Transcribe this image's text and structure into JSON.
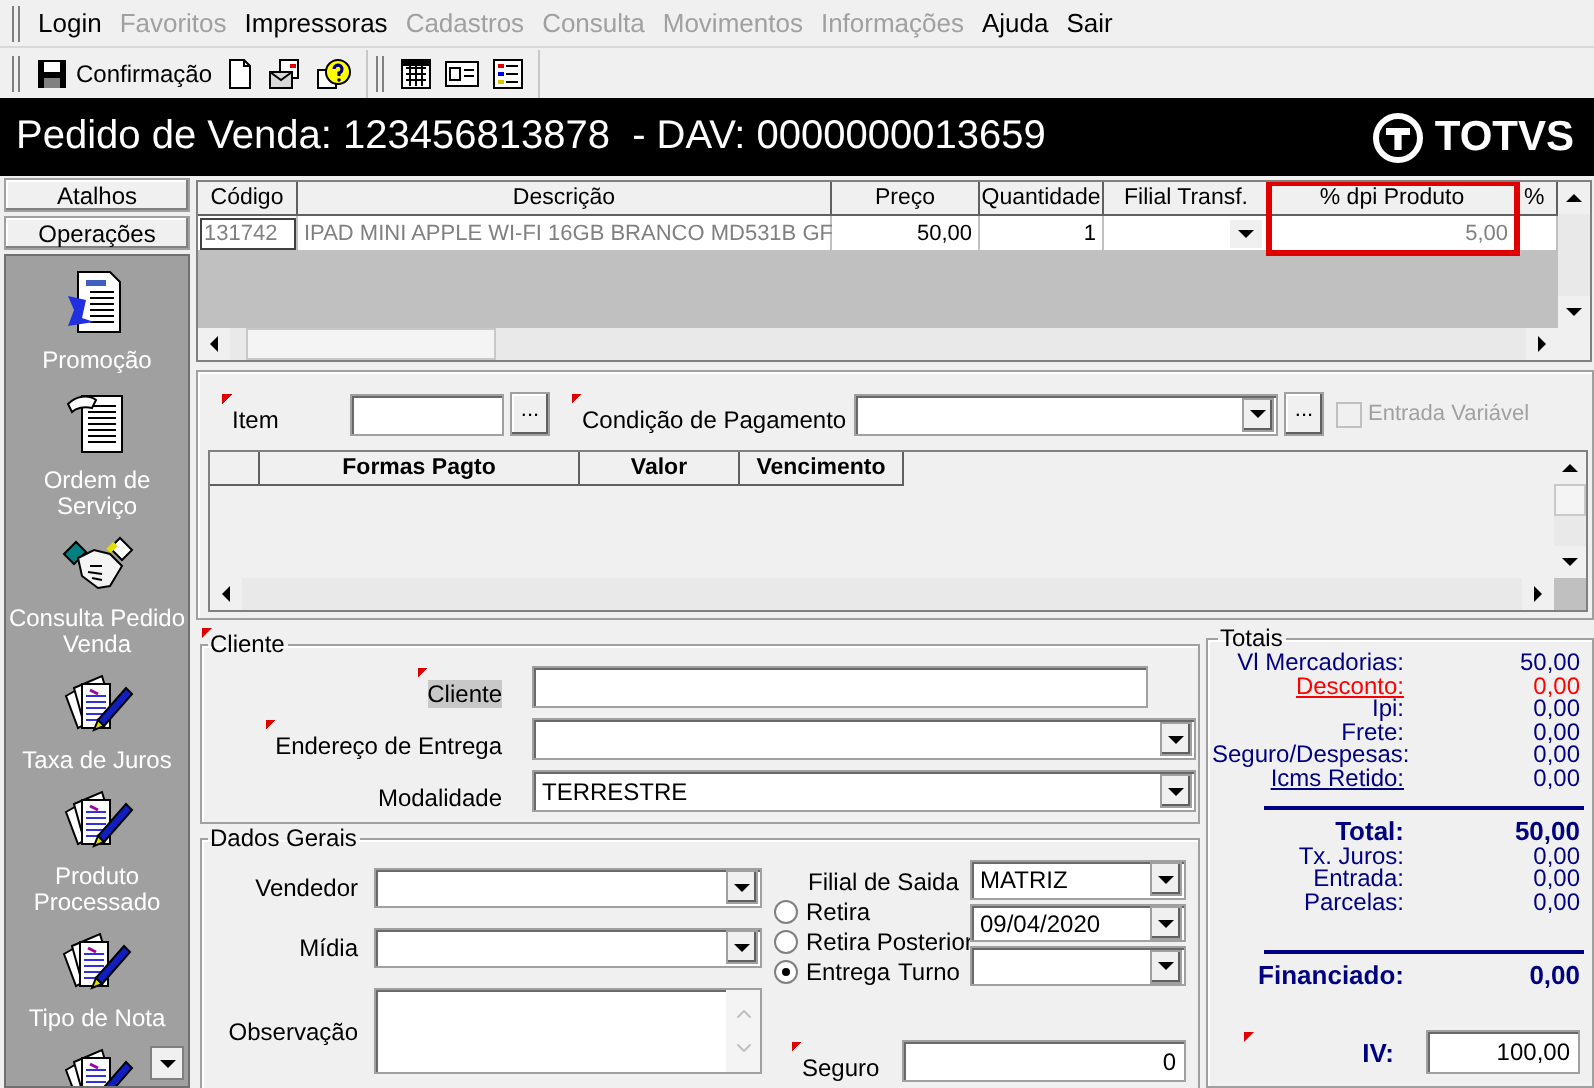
{
  "menu": [
    {
      "label": "Login",
      "disabled": false
    },
    {
      "label": "Favoritos",
      "disabled": true
    },
    {
      "label": "Impressoras",
      "disabled": false
    },
    {
      "label": "Cadastros",
      "disabled": true
    },
    {
      "label": "Consulta",
      "disabled": true
    },
    {
      "label": "Movimentos",
      "disabled": true
    },
    {
      "label": "Informações",
      "disabled": true
    },
    {
      "label": "Ajuda",
      "disabled": false
    },
    {
      "label": "Sair",
      "disabled": false
    }
  ],
  "toolbar": {
    "confirm_label": "Confirmação"
  },
  "header": {
    "title": "Pedido de Venda: 123456813878  - DAV: 0000000013659",
    "logo": "TOTVS"
  },
  "sidebar": {
    "tabs": [
      {
        "label": "Atalhos"
      },
      {
        "label": "Operações"
      }
    ],
    "items": [
      {
        "label": "Promoção",
        "kind": "report"
      },
      {
        "label": "Ordem de Serviço",
        "kind": "form"
      },
      {
        "label": "Consulta Pedido Venda",
        "kind": "handshake"
      },
      {
        "label": "Taxa de Juros",
        "kind": "papers"
      },
      {
        "label": "Produto Processado",
        "kind": "papers"
      },
      {
        "label": "Tipo de Nota",
        "kind": "papers"
      },
      {
        "kind": "papers"
      }
    ]
  },
  "products": {
    "columns": [
      {
        "label": "Código",
        "highlighted": false
      },
      {
        "label": "Descrição",
        "highlighted": false
      },
      {
        "label": "Preço",
        "highlighted": false
      },
      {
        "label": "Quantidade",
        "highlighted": false
      },
      {
        "label": "Filial Transf.",
        "highlighted": false
      },
      {
        "label": "% dpi Produto",
        "highlighted": true
      },
      {
        "label": "%",
        "highlighted": false
      }
    ],
    "rows": [
      {
        "cells": [
          {
            "text": "131742",
            "kind": "muted",
            "focused": true
          },
          {
            "text": "IPAD MINI APPLE WI-FI 16GB BRANCO MD531B  GF",
            "kind": "muted",
            "focused": false
          },
          {
            "text": "50,00",
            "kind": "number",
            "focused": false
          },
          {
            "text": "1",
            "kind": "number",
            "focused": false
          },
          {
            "kind": "select",
            "focused": false
          },
          {
            "text": "5,00",
            "kind": "muted-number",
            "focused": false
          },
          {
            "kind": "empty",
            "focused": false
          }
        ]
      }
    ]
  },
  "payment": {
    "item": {
      "label": "Item",
      "required": true,
      "button": "..."
    },
    "condition": {
      "label": "Condição de Pagamento",
      "required": true,
      "button": "..."
    },
    "variable_entry": {
      "label": "Entrada Variável",
      "checked": false,
      "disabled": true
    },
    "columns": [
      "Formas Pagto",
      "Valor",
      "Vencimento"
    ]
  },
  "client": {
    "title": "Cliente",
    "required": true,
    "fields": [
      {
        "label": "Cliente",
        "kind": "text",
        "required": true,
        "focused": true
      },
      {
        "label": "Endereço de Entrega",
        "kind": "combo",
        "required": true,
        "focused": false
      },
      {
        "label": "Modalidade",
        "kind": "combo",
        "required": false,
        "focused": false,
        "value": "TERRESTRE"
      }
    ]
  },
  "general": {
    "title": "Dados Gerais",
    "fields": [
      {
        "label": "Vendedor",
        "kind": "combo"
      },
      {
        "label": "Mídia",
        "kind": "combo"
      },
      {
        "label": "Observação",
        "kind": "memo"
      }
    ],
    "branch": {
      "label": "Filial de Saida",
      "value": "MATRIZ"
    },
    "delivery": [
      {
        "label": "Retira",
        "selected": false
      },
      {
        "label": "Retira Posterior",
        "selected": false
      },
      {
        "label": "Entrega",
        "selected": true
      }
    ],
    "date": "09/04/2020",
    "shift": {
      "label": "Turno"
    },
    "insurance": {
      "label": "Seguro",
      "value": "0",
      "required": true
    }
  },
  "totals": {
    "title": "Totais",
    "rows": [
      {
        "label": "Vl Mercadorias:",
        "value": "50,00",
        "kind": "plain"
      },
      {
        "label": "Desconto:",
        "value": "0,00",
        "kind": "alert"
      },
      {
        "label": "Ipi:",
        "value": "0,00",
        "kind": "plain"
      },
      {
        "label": "Frete:",
        "value": "0,00",
        "kind": "plain"
      },
      {
        "label": "Seguro/Despesas:",
        "value": "0,00",
        "kind": "plain"
      },
      {
        "label": "Icms Retido:",
        "value": "0,00",
        "kind": "link"
      },
      {
        "label": "Total:",
        "value": "50,00",
        "kind": "total"
      },
      {
        "label": "Tx. Juros:",
        "value": "0,00",
        "kind": "plain"
      },
      {
        "label": "Entrada:",
        "value": "0,00",
        "kind": "plain"
      },
      {
        "label": "Parcelas:",
        "value": "0,00",
        "kind": "plain"
      },
      {
        "label": "Financiado:",
        "value": "0,00",
        "kind": "total"
      }
    ],
    "iv": {
      "label": "IV:",
      "value": "100,00",
      "required": true
    }
  }
}
